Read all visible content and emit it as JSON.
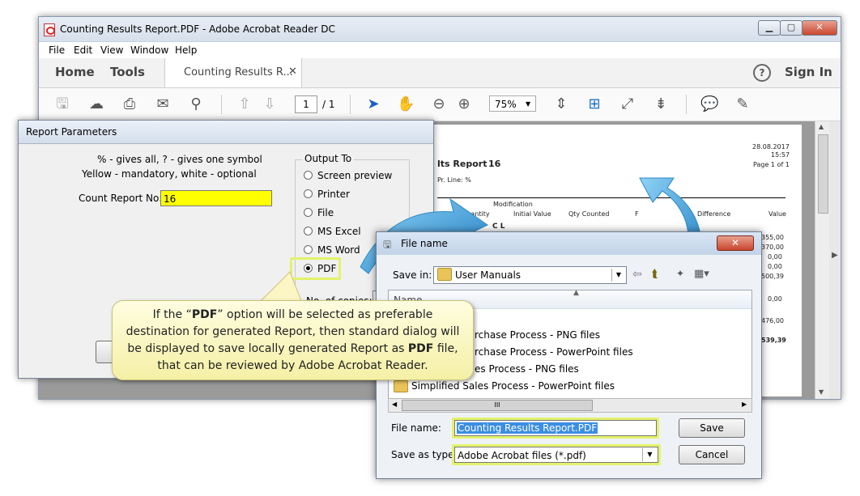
{
  "acrobat": {
    "title": "Counting Results Report.PDF - Adobe Acrobat Reader DC",
    "menu": [
      "File",
      "Edit",
      "View",
      "Window",
      "Help"
    ],
    "nav": {
      "home": "Home",
      "tools": "Tools",
      "sign_in": "Sign In"
    },
    "doc_tab": "Counting Results R...",
    "page_current": "1",
    "page_total": "/ 1",
    "zoom": "75%",
    "report_page": {
      "date": "28.08.2017",
      "time": "15:57",
      "page_of": "Page 1 of 1",
      "title_part": "lts Report",
      "number": "16",
      "line": "Pr. Line: %",
      "col_modification": "Modification",
      "col_quantity": "Quantity",
      "col_initial": "Initial Value",
      "col_counted": "Qty Counted",
      "col_f": "F",
      "col_difference": "Difference",
      "col_value": "Value",
      "group": "C L",
      "values": [
        "355,00",
        "370,00",
        "0,00",
        "0,00",
        "500,39",
        "0,00",
        "476,00",
        "539,39"
      ]
    }
  },
  "report_params": {
    "title": "Report Parameters",
    "hint1": "% - gives all, ? - gives one symbol",
    "hint2": "Yellow - mandatory, white - optional",
    "count_label": "Count Report No:",
    "count_value": "16",
    "output_label": "Output To",
    "options": [
      "Screen preview",
      "Printer",
      "File",
      "MS Excel",
      "MS Word",
      "PDF"
    ],
    "selected": "PDF",
    "copies_label": "No. of copies:"
  },
  "file_dialog": {
    "title": "File name",
    "save_in_label": "Save in:",
    "save_in_value": "User Manuals",
    "col_name": "Name",
    "items": [
      "rchase Process - PNG files",
      "rchase Process - PowerPoint files",
      "es Process - PNG files",
      "Simplified Sales Process - PowerPoint files"
    ],
    "scroll_mid": "III",
    "file_name_label": "File name:",
    "file_name_value": "Counting Results Report.PDF",
    "save_type_label": "Save as type:",
    "save_type_value": "Adobe Acrobat files (*.pdf)",
    "save_button": "Save",
    "cancel_button": "Cancel"
  },
  "callout": {
    "pre1": "If the “",
    "b1": "PDF",
    "mid": "” option will be selected as preferable destination for generated Report, then standard dialog will be displayed to save locally generated Report as ",
    "b2": "PDF",
    "post": " file, that can be reviewed by Adobe Acrobat Reader."
  },
  "colors": {
    "highlight": "#e3f26b",
    "mandatory": "#ffff00",
    "arrow": "#3aa0dd",
    "callout_bg": "#f8f3b4"
  }
}
